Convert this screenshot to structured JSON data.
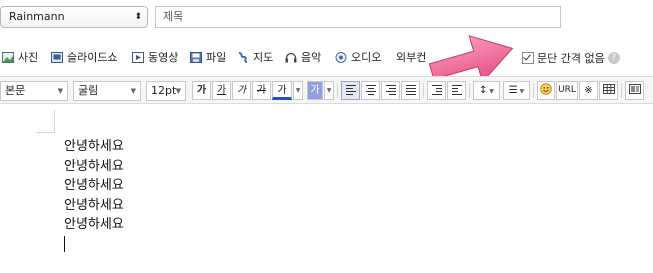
{
  "header": {
    "blog_select": "Rainmann",
    "title_placeholder": "제목"
  },
  "attach_toolbar": {
    "items": [
      {
        "label": "사진",
        "icon": "photo-icon"
      },
      {
        "label": "슬라이드쇼",
        "icon": "slideshow-icon"
      },
      {
        "label": "동영상",
        "icon": "video-icon"
      },
      {
        "label": "파일",
        "icon": "file-icon"
      },
      {
        "label": "지도",
        "icon": "map-icon"
      },
      {
        "label": "음악",
        "icon": "headphones-icon"
      },
      {
        "label": "오디오",
        "icon": "audio-icon"
      },
      {
        "label": "외부컨"
      }
    ],
    "paragraph_option": {
      "label": "문단 간격 없음",
      "checked": true,
      "help": "?"
    }
  },
  "format_toolbar": {
    "paragraph_style": "본문",
    "font_family": "굴림",
    "font_size": "12pt",
    "bold": "가",
    "underline": "가",
    "italic": "가",
    "strike": "가",
    "font_color": "가",
    "bg_color": "가",
    "url": "URL",
    "special_char": "※"
  },
  "editor": {
    "lines": [
      "안녕하세요",
      "안녕하세요",
      "안녕하세요",
      "안녕하세요",
      "안녕하세요"
    ]
  },
  "colors": {
    "arrow": "#f0699a",
    "font_color_underline": "#2b4dbb",
    "bg_color_button": "#8f9fe0"
  }
}
